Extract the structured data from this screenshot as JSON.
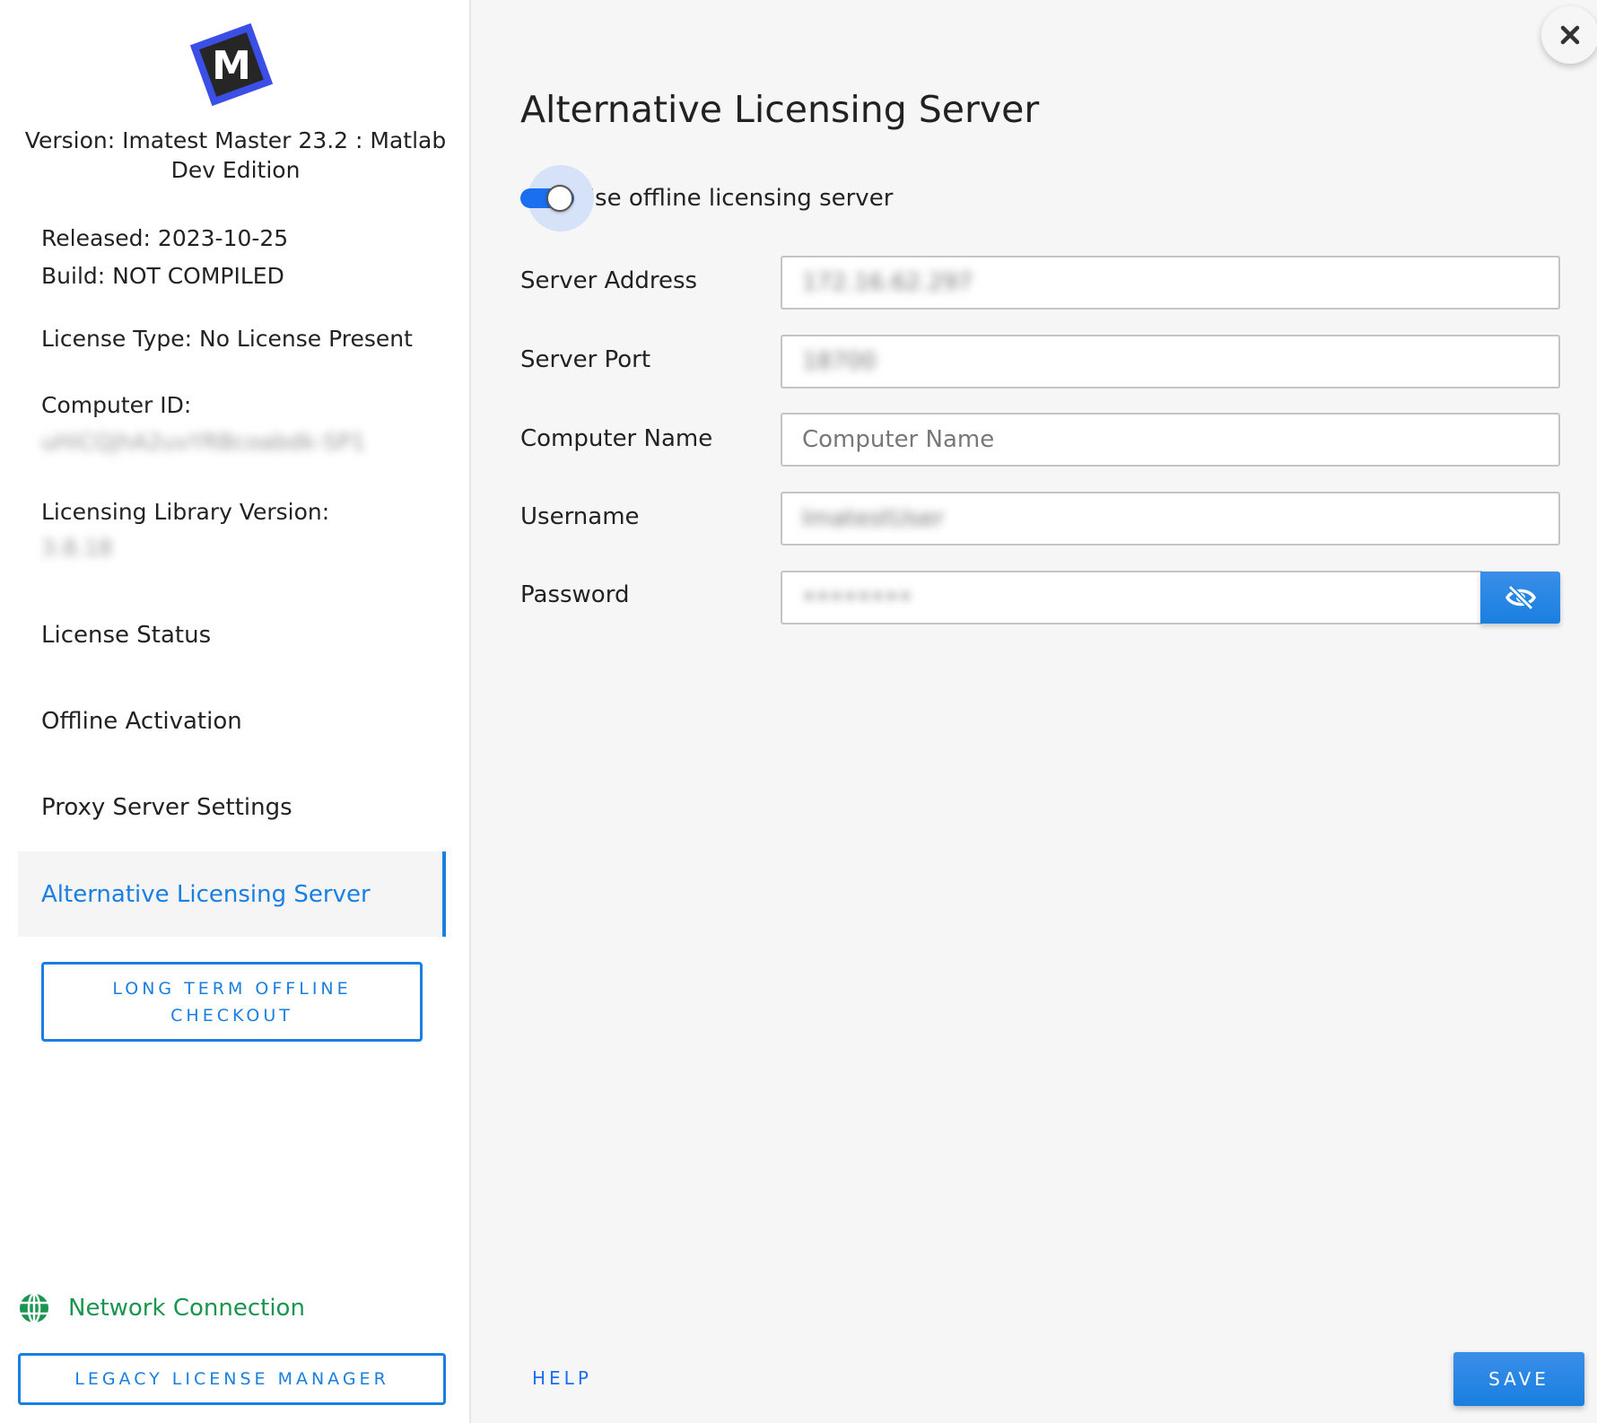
{
  "sidebar": {
    "logo_letter": "M",
    "version": "Version: Imatest Master 23.2 : Matlab Dev Edition",
    "released": "Released: 2023-10-25",
    "build": "Build: NOT COMPILED",
    "license_type": "License Type: No License Present",
    "computer_id_label": "Computer ID:",
    "computer_id_value": "uHiCQjhA2uvYRBcoabdk-SP1",
    "lib_version_label": "Licensing Library Version:",
    "lib_version_value": "3.8.18",
    "nav_items": [
      {
        "label": "License Status",
        "active": false
      },
      {
        "label": "Offline Activation",
        "active": false
      },
      {
        "label": "Proxy Server Settings",
        "active": false
      },
      {
        "label": "Alternative Licensing Server",
        "active": true
      }
    ],
    "long_term_button": "LONG TERM OFFLINE CHECKOUT",
    "network_status": "Network Connection",
    "legacy_button": "LEGACY LICENSE MANAGER"
  },
  "main": {
    "title": "Alternative Licensing Server",
    "toggle": {
      "label": "Use offline licensing server",
      "checked": true
    },
    "fields": [
      {
        "label": "Server Address",
        "value": "172.16.62.297",
        "placeholder": ""
      },
      {
        "label": "Server Port",
        "value": "18700",
        "placeholder": ""
      },
      {
        "label": "Computer Name",
        "value": "",
        "placeholder": "Computer Name"
      },
      {
        "label": "Username",
        "value": "ImatestUser",
        "placeholder": ""
      },
      {
        "label": "Password",
        "value": "••••••••",
        "placeholder": ""
      }
    ],
    "help_label": "HELP",
    "save_label": "SAVE"
  },
  "colors": {
    "accent": "#1a7fe0",
    "network_ok": "#1a9550"
  }
}
